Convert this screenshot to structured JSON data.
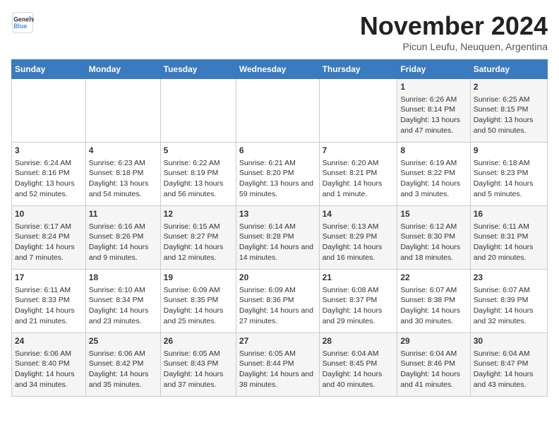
{
  "logo": {
    "line1": "General",
    "line2": "Blue"
  },
  "title": "November 2024",
  "location": "Picun Leufu, Neuquen, Argentina",
  "days_of_week": [
    "Sunday",
    "Monday",
    "Tuesday",
    "Wednesday",
    "Thursday",
    "Friday",
    "Saturday"
  ],
  "weeks": [
    [
      {
        "day": "",
        "content": ""
      },
      {
        "day": "",
        "content": ""
      },
      {
        "day": "",
        "content": ""
      },
      {
        "day": "",
        "content": ""
      },
      {
        "day": "",
        "content": ""
      },
      {
        "day": "1",
        "content": "Sunrise: 6:26 AM\nSunset: 8:14 PM\nDaylight: 13 hours and 47 minutes."
      },
      {
        "day": "2",
        "content": "Sunrise: 6:25 AM\nSunset: 8:15 PM\nDaylight: 13 hours and 50 minutes."
      }
    ],
    [
      {
        "day": "3",
        "content": "Sunrise: 6:24 AM\nSunset: 8:16 PM\nDaylight: 13 hours and 52 minutes."
      },
      {
        "day": "4",
        "content": "Sunrise: 6:23 AM\nSunset: 8:18 PM\nDaylight: 13 hours and 54 minutes."
      },
      {
        "day": "5",
        "content": "Sunrise: 6:22 AM\nSunset: 8:19 PM\nDaylight: 13 hours and 56 minutes."
      },
      {
        "day": "6",
        "content": "Sunrise: 6:21 AM\nSunset: 8:20 PM\nDaylight: 13 hours and 59 minutes."
      },
      {
        "day": "7",
        "content": "Sunrise: 6:20 AM\nSunset: 8:21 PM\nDaylight: 14 hours and 1 minute."
      },
      {
        "day": "8",
        "content": "Sunrise: 6:19 AM\nSunset: 8:22 PM\nDaylight: 14 hours and 3 minutes."
      },
      {
        "day": "9",
        "content": "Sunrise: 6:18 AM\nSunset: 8:23 PM\nDaylight: 14 hours and 5 minutes."
      }
    ],
    [
      {
        "day": "10",
        "content": "Sunrise: 6:17 AM\nSunset: 8:24 PM\nDaylight: 14 hours and 7 minutes."
      },
      {
        "day": "11",
        "content": "Sunrise: 6:16 AM\nSunset: 8:26 PM\nDaylight: 14 hours and 9 minutes."
      },
      {
        "day": "12",
        "content": "Sunrise: 6:15 AM\nSunset: 8:27 PM\nDaylight: 14 hours and 12 minutes."
      },
      {
        "day": "13",
        "content": "Sunrise: 6:14 AM\nSunset: 8:28 PM\nDaylight: 14 hours and 14 minutes."
      },
      {
        "day": "14",
        "content": "Sunrise: 6:13 AM\nSunset: 8:29 PM\nDaylight: 14 hours and 16 minutes."
      },
      {
        "day": "15",
        "content": "Sunrise: 6:12 AM\nSunset: 8:30 PM\nDaylight: 14 hours and 18 minutes."
      },
      {
        "day": "16",
        "content": "Sunrise: 6:11 AM\nSunset: 8:31 PM\nDaylight: 14 hours and 20 minutes."
      }
    ],
    [
      {
        "day": "17",
        "content": "Sunrise: 6:11 AM\nSunset: 8:33 PM\nDaylight: 14 hours and 21 minutes."
      },
      {
        "day": "18",
        "content": "Sunrise: 6:10 AM\nSunset: 8:34 PM\nDaylight: 14 hours and 23 minutes."
      },
      {
        "day": "19",
        "content": "Sunrise: 6:09 AM\nSunset: 8:35 PM\nDaylight: 14 hours and 25 minutes."
      },
      {
        "day": "20",
        "content": "Sunrise: 6:09 AM\nSunset: 8:36 PM\nDaylight: 14 hours and 27 minutes."
      },
      {
        "day": "21",
        "content": "Sunrise: 6:08 AM\nSunset: 8:37 PM\nDaylight: 14 hours and 29 minutes."
      },
      {
        "day": "22",
        "content": "Sunrise: 6:07 AM\nSunset: 8:38 PM\nDaylight: 14 hours and 30 minutes."
      },
      {
        "day": "23",
        "content": "Sunrise: 6:07 AM\nSunset: 8:39 PM\nDaylight: 14 hours and 32 minutes."
      }
    ],
    [
      {
        "day": "24",
        "content": "Sunrise: 6:06 AM\nSunset: 8:40 PM\nDaylight: 14 hours and 34 minutes."
      },
      {
        "day": "25",
        "content": "Sunrise: 6:06 AM\nSunset: 8:42 PM\nDaylight: 14 hours and 35 minutes."
      },
      {
        "day": "26",
        "content": "Sunrise: 6:05 AM\nSunset: 8:43 PM\nDaylight: 14 hours and 37 minutes."
      },
      {
        "day": "27",
        "content": "Sunrise: 6:05 AM\nSunset: 8:44 PM\nDaylight: 14 hours and 38 minutes."
      },
      {
        "day": "28",
        "content": "Sunrise: 6:04 AM\nSunset: 8:45 PM\nDaylight: 14 hours and 40 minutes."
      },
      {
        "day": "29",
        "content": "Sunrise: 6:04 AM\nSunset: 8:46 PM\nDaylight: 14 hours and 41 minutes."
      },
      {
        "day": "30",
        "content": "Sunrise: 6:04 AM\nSunset: 8:47 PM\nDaylight: 14 hours and 43 minutes."
      }
    ]
  ]
}
